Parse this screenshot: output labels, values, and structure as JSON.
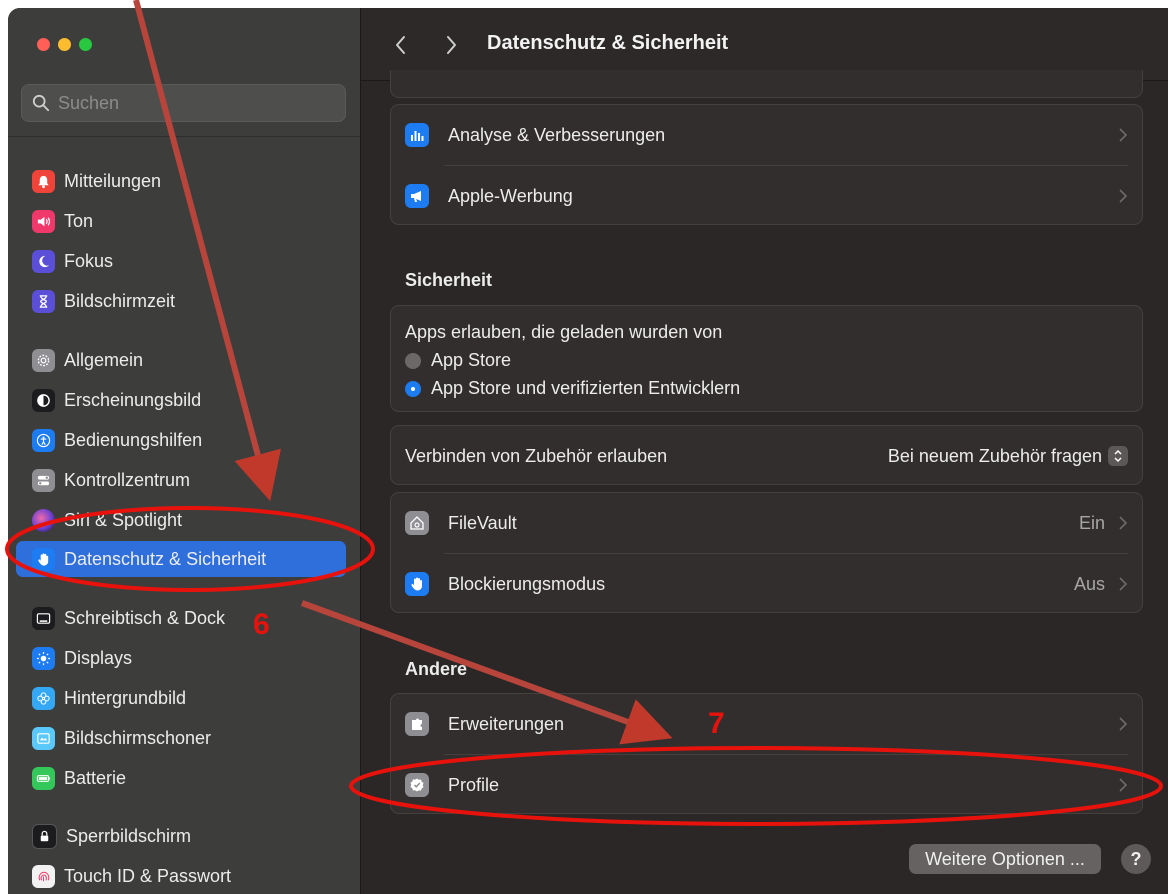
{
  "window": {
    "traffic_lights": [
      "#ff5f57",
      "#febc2e",
      "#28c840"
    ]
  },
  "search": {
    "placeholder": "Suchen"
  },
  "sidebar": {
    "items": [
      {
        "label": "Mitteilungen",
        "icon": "bell-icon",
        "color": "#f0433a"
      },
      {
        "label": "Ton",
        "icon": "speaker-icon",
        "color": "#f0386b"
      },
      {
        "label": "Fokus",
        "icon": "moon-icon",
        "color": "#5a4fd6"
      },
      {
        "label": "Bildschirmzeit",
        "icon": "hourglass-icon",
        "color": "#5a4fd6"
      },
      {
        "label": "Allgemein",
        "icon": "gear-icon",
        "color": "#8e8e93"
      },
      {
        "label": "Erscheinungsbild",
        "icon": "appearance-icon",
        "color": "#1c1c1e"
      },
      {
        "label": "Bedienungshilfen",
        "icon": "accessibility-icon",
        "color": "#1d7cf2"
      },
      {
        "label": "Kontrollzentrum",
        "icon": "toggles-icon",
        "color": "#8e8e93"
      },
      {
        "label": "Siri & Spotlight",
        "icon": "siri-icon",
        "color": "#6a3fd1"
      },
      {
        "label": "Datenschutz & Sicherheit",
        "icon": "hand-icon",
        "color": "#1d7cf2",
        "selected": true
      },
      {
        "label": "Schreibtisch & Dock",
        "icon": "dock-icon",
        "color": "#1c1c1e"
      },
      {
        "label": "Displays",
        "icon": "sun-icon",
        "color": "#1d7cf2"
      },
      {
        "label": "Hintergrundbild",
        "icon": "flower-icon",
        "color": "#34a8f5"
      },
      {
        "label": "Bildschirmschoner",
        "icon": "screensaver-icon",
        "color": "#5ac8fa"
      },
      {
        "label": "Batterie",
        "icon": "battery-icon",
        "color": "#34c759"
      },
      {
        "label": "Sperrbildschirm",
        "icon": "lock-icon",
        "color": "#1c1c1e"
      },
      {
        "label": "Touch ID & Passwort",
        "icon": "fingerprint-icon",
        "color": "#f2f2f2"
      }
    ]
  },
  "header": {
    "title": "Datenschutz & Sicherheit"
  },
  "main": {
    "analytics": {
      "label": "Analyse & Verbesserungen",
      "icon": "chart-icon"
    },
    "ads": {
      "label": "Apple-Werbung",
      "icon": "megaphone-icon"
    },
    "security_title": "Sicherheit",
    "apps_allowed": {
      "label": "Apps erlauben, die geladen wurden von",
      "options": [
        "App Store",
        "App Store und verifizierten Entwicklern"
      ],
      "selected_index": 1
    },
    "accessories": {
      "label": "Verbinden von Zubehör erlauben",
      "value": "Bei neuem Zubehör fragen"
    },
    "filevault": {
      "label": "FileVault",
      "value": "Ein",
      "icon": "house-lock-icon"
    },
    "lockdown": {
      "label": "Blockierungsmodus",
      "value": "Aus",
      "icon": "hand-icon"
    },
    "other_title": "Andere",
    "extensions": {
      "label": "Erweiterungen",
      "icon": "puzzle-icon"
    },
    "profiles": {
      "label": "Profile",
      "icon": "badge-check-icon"
    },
    "more_options": "Weitere Optionen ...",
    "help": "?"
  },
  "annotations": {
    "step6": "6",
    "step7": "7",
    "color": "#c0392b",
    "circle_color": "#e8120c"
  }
}
